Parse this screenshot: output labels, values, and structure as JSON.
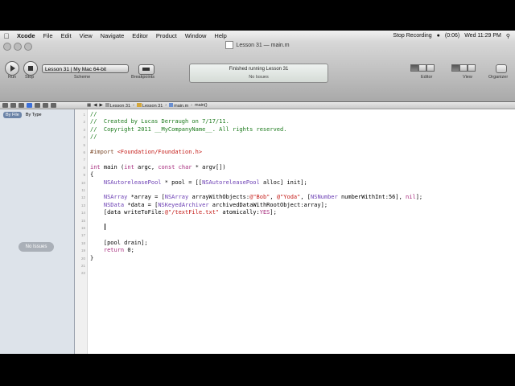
{
  "menubar": {
    "apple": "",
    "app": "Xcode",
    "items": [
      "File",
      "Edit",
      "View",
      "Navigate",
      "Editor",
      "Product",
      "Window",
      "Help"
    ],
    "status_recording": "Stop Recording",
    "battery": "(0:06)",
    "clock": "Wed 11:29 PM"
  },
  "window": {
    "title": "Lesson 31 — main.m"
  },
  "toolbar": {
    "run_label": "Run",
    "stop_label": "Stop",
    "scheme_label": "Scheme",
    "scheme_value": "Lesson 31  |  My Mac 64-bit",
    "breakpoints_label": "Breakpoints",
    "activity_status": "Finished running Lesson 31",
    "activity_issues": "No Issues",
    "editor_label": "Editor",
    "view_label": "View",
    "organizer_label": "Organizer"
  },
  "jumpbar": {
    "crumbs": [
      "Lesson 31",
      "Lesson 31",
      "main.m",
      "main()"
    ]
  },
  "navigator": {
    "filters": [
      "By File",
      "By Type"
    ],
    "no_issues": "No Issues"
  },
  "editor": {
    "lines": [
      {
        "n": "1",
        "t": "//"
      },
      {
        "n": "2",
        "t": "//  Created by Lucas Derraugh on 7/17/11."
      },
      {
        "n": "3",
        "t": "//  Copyright 2011 __MyCompanyName__. All rights reserved."
      },
      {
        "n": "4",
        "t": "//"
      },
      {
        "n": "5",
        "t": ""
      },
      {
        "n": "6",
        "t": "#import <Foundation/Foundation.h>"
      },
      {
        "n": "7",
        "t": ""
      },
      {
        "n": "8",
        "t": "int main (int argc, const char * argv[])"
      },
      {
        "n": "9",
        "t": "{"
      },
      {
        "n": "10",
        "t": "    NSAutoreleasePool * pool = [[NSAutoreleasePool alloc] init];"
      },
      {
        "n": "11",
        "t": ""
      },
      {
        "n": "12",
        "t": "    NSArray *array = [NSArray arrayWithObjects:@\"Bob\", @\"Yoda\", [NSNumber numberWithInt:56], nil];"
      },
      {
        "n": "13",
        "t": "    NSData *data = [NSKeyedArchiver archivedDataWithRootObject:array];"
      },
      {
        "n": "14",
        "t": "    [data writeToFile:@\"/textFile.txt\" atomically:YES];"
      },
      {
        "n": "15",
        "t": ""
      },
      {
        "n": "16",
        "t": ""
      },
      {
        "n": "17",
        "t": ""
      },
      {
        "n": "18",
        "t": "    [pool drain];"
      },
      {
        "n": "19",
        "t": "    return 0;"
      },
      {
        "n": "20",
        "t": "}"
      },
      {
        "n": "21",
        "t": ""
      },
      {
        "n": "22",
        "t": ""
      }
    ]
  }
}
